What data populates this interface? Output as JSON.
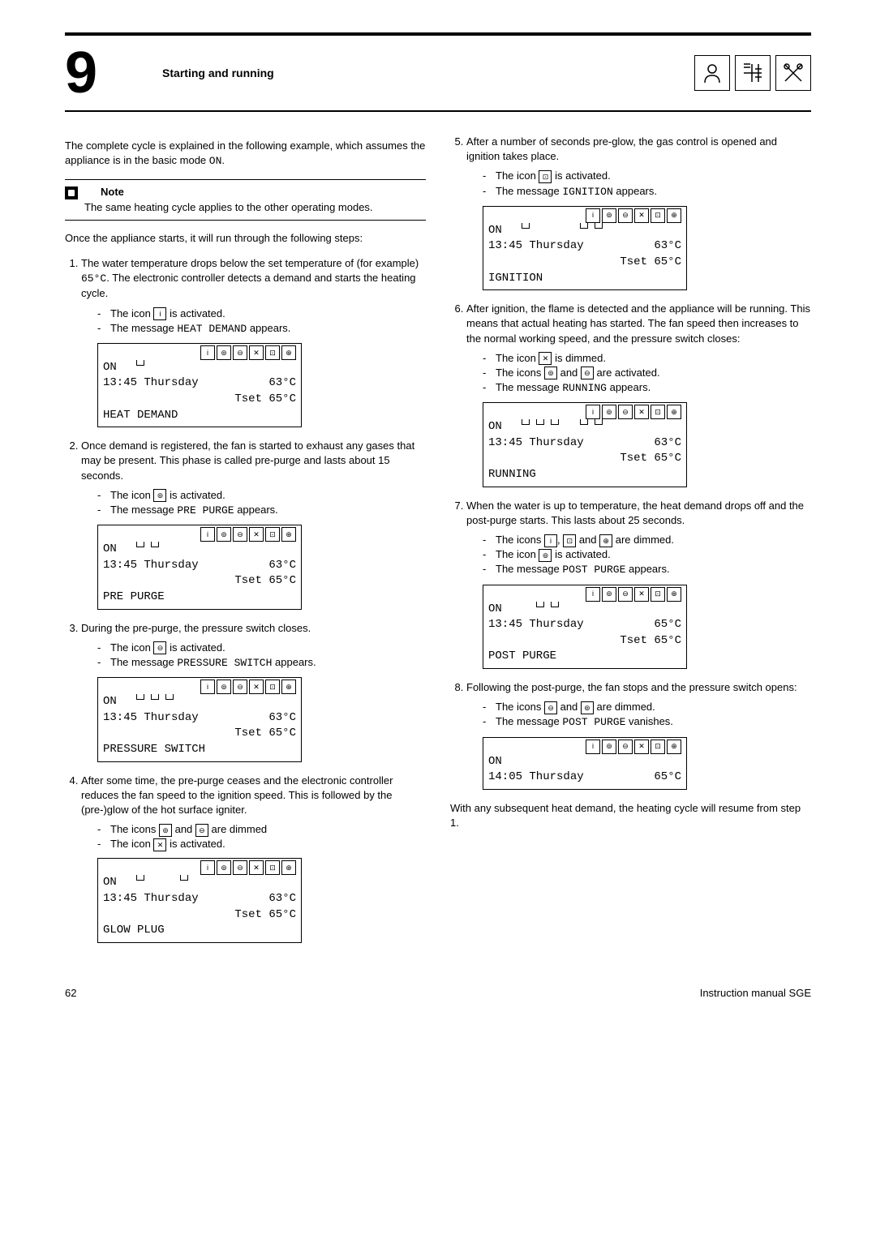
{
  "chapter": {
    "number": "9",
    "title": "Starting and running"
  },
  "intro": "The complete cycle is explained in the following example, which assumes the appliance is in the basic mode ON.",
  "note": {
    "title": "Note",
    "body": "The same heating cycle applies to the other operating modes."
  },
  "preSteps": "Once the appliance starts, it will run through the following steps:",
  "steps": [
    {
      "n": "1.",
      "text_before": "The water temperature drops below the set temperature of (for example) ",
      "mono": "65°C",
      "text_after": ". The electronic controller detects a demand and starts the heating cycle.",
      "subs": [
        {
          "pre": "The icon ",
          "icon": "i",
          "post": " is activated."
        },
        {
          "pre": "The message ",
          "mono": "HEAT DEMAND",
          "post": " appears."
        }
      ],
      "display": {
        "state": "ON",
        "act": [
          true,
          false,
          false,
          false,
          false,
          false
        ],
        "time": "13:45",
        "day": "Thursday",
        "temp": "63°C",
        "tset": "Tset 65°C",
        "msg": "HEAT DEMAND"
      }
    },
    {
      "n": "2.",
      "text_before": "Once demand is registered, the fan is started to exhaust any gases that may be present. This phase is called pre-purge and lasts about 15 seconds.",
      "subs": [
        {
          "pre": "The icon ",
          "icon": "⊚",
          "post": " is activated."
        },
        {
          "pre": "The message ",
          "mono": "PRE PURGE",
          "post": " appears."
        }
      ],
      "display": {
        "state": "ON",
        "act": [
          true,
          true,
          false,
          false,
          false,
          false
        ],
        "time": "13:45",
        "day": "Thursday",
        "temp": "63°C",
        "tset": "Tset 65°C",
        "msg": "PRE PURGE"
      }
    },
    {
      "n": "3.",
      "text_before": "During the pre-purge, the pressure switch closes.",
      "subs": [
        {
          "pre": "The icon ",
          "icon": "⊖",
          "post": " is activated."
        },
        {
          "pre": "The message ",
          "mono": "PRESSURE SWITCH",
          "post": " appears."
        }
      ],
      "display": {
        "state": "ON",
        "act": [
          true,
          true,
          true,
          false,
          false,
          false
        ],
        "time": "13:45",
        "day": "Thursday",
        "temp": "63°C",
        "tset": "Tset 65°C",
        "msg": "PRESSURE SWITCH"
      }
    },
    {
      "n": "4.",
      "text_before": "After some time, the pre-purge ceases and the electronic controller reduces the fan speed to the ignition speed. This is followed by the (pre-)glow of the hot surface igniter.",
      "subs": [
        {
          "pre": "The icons ",
          "icon": "⊚",
          "mid": " and ",
          "icon2": "⊖",
          "post": " are dimmed"
        },
        {
          "pre": "The icon ",
          "icon": "✕",
          "post": " is activated."
        }
      ],
      "display": {
        "state": "ON",
        "act": [
          true,
          false,
          false,
          true,
          false,
          false
        ],
        "time": "13:45",
        "day": "Thursday",
        "temp": "63°C",
        "tset": "Tset 65°C",
        "msg": "GLOW PLUG"
      }
    },
    {
      "n": "5.",
      "text_before": "After a number of seconds pre-glow, the gas control is opened and ignition takes place.",
      "subs": [
        {
          "pre": "The icon ",
          "icon": "⊡",
          "post": " is activated."
        },
        {
          "pre": "The message ",
          "mono": "IGNITION",
          "post": " appears."
        }
      ],
      "display": {
        "state": "ON",
        "act": [
          true,
          false,
          false,
          false,
          true,
          true
        ],
        "time": "13:45",
        "day": "Thursday",
        "temp": "63°C",
        "tset": "Tset 65°C",
        "msg": "IGNITION"
      }
    },
    {
      "n": "6.",
      "text_before": "After ignition, the flame is detected and the appliance will be running. This means that actual heating has started. The fan speed then increases to the normal working speed, and the pressure switch closes:",
      "subs": [
        {
          "pre": "The icon ",
          "icon": "✕",
          "post": " is dimmed."
        },
        {
          "pre": "The icons ",
          "icon": "⊚",
          "mid": " and ",
          "icon2": "⊖",
          "post": " are activated."
        },
        {
          "pre": "The message ",
          "mono": "RUNNING",
          "post": " appears."
        }
      ],
      "display": {
        "state": "ON",
        "act": [
          true,
          true,
          true,
          false,
          true,
          true
        ],
        "time": "13:45",
        "day": "Thursday",
        "temp": "63°C",
        "tset": "Tset 65°C",
        "msg": "RUNNING"
      }
    },
    {
      "n": "7.",
      "text_before": "When the water is up to temperature, the heat demand drops off and the post-purge starts. This lasts about 25 seconds.",
      "subs": [
        {
          "pre": "The icons ",
          "icon": "i",
          "mid": ", ",
          "icon2": "⊡",
          "mid2": " and ",
          "icon3": "⊕",
          "post": " are dimmed."
        },
        {
          "pre": "The icon ",
          "icon": "⊚",
          "post": " is activated."
        },
        {
          "pre": "The message ",
          "mono": "POST PURGE",
          "post": " appears."
        }
      ],
      "display": {
        "state": "ON",
        "act": [
          false,
          true,
          true,
          false,
          false,
          false
        ],
        "time": "13:45",
        "day": "Thursday",
        "temp": "65°C",
        "tset": "Tset 65°C",
        "msg": "POST PURGE"
      }
    },
    {
      "n": "8.",
      "text_before": "Following the post-purge, the fan stops and the pressure switch opens:",
      "subs": [
        {
          "pre": "The icons ",
          "icon": "⊖",
          "mid": " and ",
          "icon2": "⊚",
          "post": " are dimmed."
        },
        {
          "pre": "The message ",
          "mono": "POST PURGE",
          "post": " vanishes."
        }
      ],
      "display": {
        "state": "ON",
        "act": [
          false,
          false,
          false,
          false,
          false,
          false
        ],
        "time": "14:05",
        "day": "Thursday",
        "temp": "65°C",
        "tset": "",
        "msg": ""
      }
    }
  ],
  "outro": "With any subsequent heat demand, the heating cycle will resume from step 1.",
  "footer": {
    "page": "62",
    "doc": "Instruction manual SGE"
  }
}
